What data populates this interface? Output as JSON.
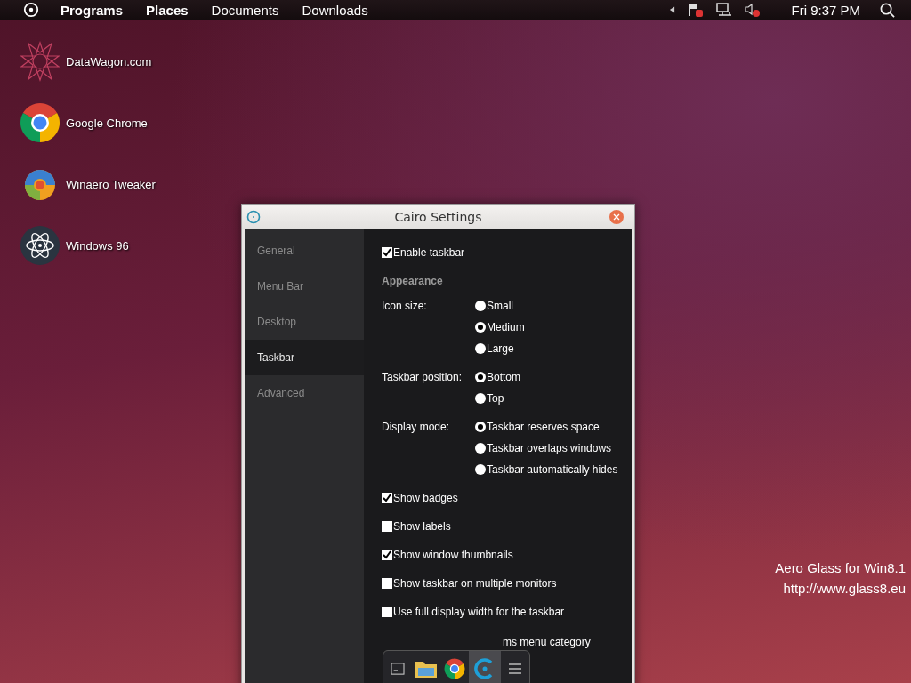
{
  "menu_bar": {
    "items": [
      {
        "label": "Programs",
        "bold": true
      },
      {
        "label": "Places",
        "bold": true
      },
      {
        "label": "Documents",
        "bold": false
      },
      {
        "label": "Downloads",
        "bold": false
      }
    ],
    "clock": "Fri 9:37 PM"
  },
  "desktop_icons": [
    {
      "label": "DataWagon.com",
      "kind": "star"
    },
    {
      "label": "Google Chrome",
      "kind": "chrome"
    },
    {
      "label": "Winaero Tweaker",
      "kind": "swirl"
    },
    {
      "label": "Windows 96",
      "kind": "atom"
    }
  ],
  "window": {
    "title": "Cairo Settings"
  },
  "sidebar": [
    {
      "label": "General",
      "selected": false
    },
    {
      "label": "Menu Bar",
      "selected": false
    },
    {
      "label": "Desktop",
      "selected": false
    },
    {
      "label": "Taskbar",
      "selected": true
    },
    {
      "label": "Advanced",
      "selected": false
    }
  ],
  "settings": [
    {
      "kind": "checkbox",
      "label": "Enable taskbar",
      "checked": true
    },
    {
      "kind": "heading",
      "label": "Appearance"
    },
    {
      "kind": "radio",
      "label": "Icon size:",
      "options": [
        {
          "label": "Small",
          "selected": false
        },
        {
          "label": "Medium",
          "selected": true
        },
        {
          "label": "Large",
          "selected": false
        }
      ]
    },
    {
      "kind": "radio",
      "label": "Taskbar position:",
      "options": [
        {
          "label": "Bottom",
          "selected": true
        },
        {
          "label": "Top",
          "selected": false
        }
      ]
    },
    {
      "kind": "radio",
      "label": "Display mode:",
      "options": [
        {
          "label": "Taskbar reserves space",
          "selected": true
        },
        {
          "label": "Taskbar overlaps windows",
          "selected": false
        },
        {
          "label": "Taskbar automatically hides",
          "selected": false
        }
      ]
    },
    {
      "kind": "checkbox",
      "label": "Show badges",
      "checked": true
    },
    {
      "kind": "checkbox",
      "label": "Show labels",
      "checked": false
    },
    {
      "kind": "checkbox",
      "label": "Show window thumbnails",
      "checked": true
    },
    {
      "kind": "checkbox",
      "label": "Show taskbar on multiple monitors",
      "checked": false
    },
    {
      "kind": "checkbox",
      "label": "Use full display width for the taskbar",
      "checked": false
    },
    {
      "kind": "partial",
      "label": "ms menu category"
    }
  ],
  "taskbar": [
    {
      "kind": "terminal",
      "selected": false
    },
    {
      "kind": "folder",
      "selected": false
    },
    {
      "kind": "chrome",
      "selected": false
    },
    {
      "kind": "cairo",
      "selected": true
    },
    {
      "kind": "menu",
      "selected": false
    }
  ],
  "overlay_text": [
    "Aero Glass for Win8.1",
    "http://www.glass8.eu"
  ]
}
